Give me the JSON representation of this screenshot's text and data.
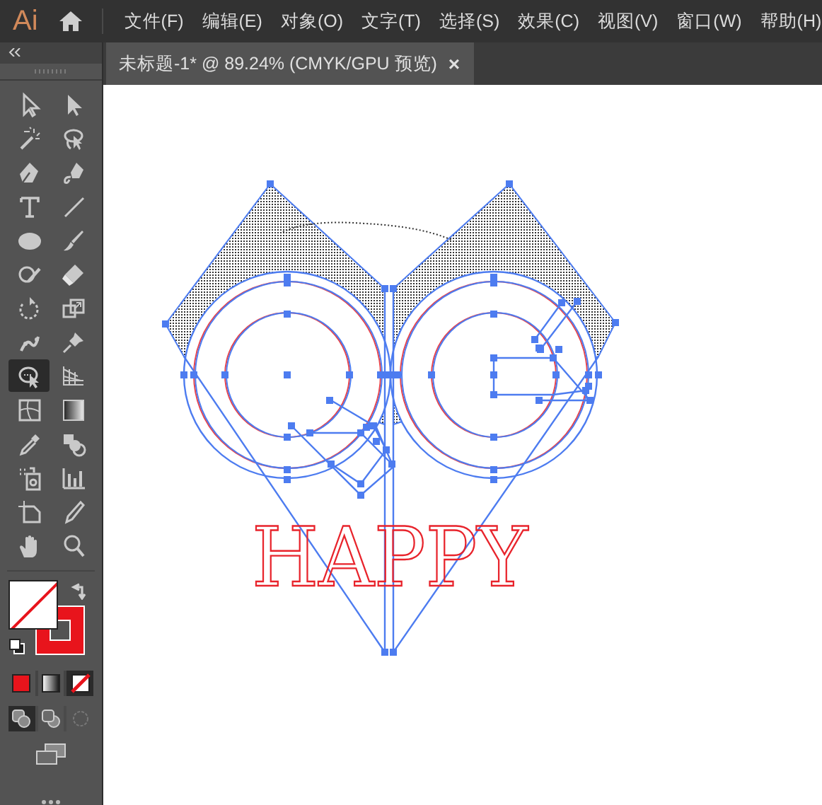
{
  "app": {
    "logo": "Ai"
  },
  "menu": [
    "文件(F)",
    "编辑(E)",
    "对象(O)",
    "文字(T)",
    "选择(S)",
    "效果(C)",
    "视图(V)",
    "窗口(W)",
    "帮助(H)"
  ],
  "document_tab": {
    "title": "未标题-1* @ 89.24% (CMYK/GPU 预览)",
    "close": "×"
  },
  "tools": [
    {
      "kind": "selection",
      "selected": false
    },
    {
      "kind": "direct-selection",
      "selected": false
    },
    {
      "kind": "magic-wand",
      "selected": false
    },
    {
      "kind": "lasso",
      "selected": false
    },
    {
      "kind": "pen",
      "selected": false
    },
    {
      "kind": "curvature",
      "selected": false
    },
    {
      "kind": "type",
      "selected": false
    },
    {
      "kind": "line",
      "selected": false
    },
    {
      "kind": "ellipse",
      "selected": false
    },
    {
      "kind": "brush",
      "selected": false
    },
    {
      "kind": "shaper",
      "selected": false
    },
    {
      "kind": "eraser",
      "selected": false
    },
    {
      "kind": "rotate",
      "selected": false
    },
    {
      "kind": "scale",
      "selected": false
    },
    {
      "kind": "puppet",
      "selected": false
    },
    {
      "kind": "pin",
      "selected": false
    },
    {
      "kind": "free-transform",
      "selected": true
    },
    {
      "kind": "perspective",
      "selected": false
    },
    {
      "kind": "mesh",
      "selected": false
    },
    {
      "kind": "gradient",
      "selected": false
    },
    {
      "kind": "eyedropper",
      "selected": false
    },
    {
      "kind": "blend",
      "selected": false
    },
    {
      "kind": "spray",
      "selected": false
    },
    {
      "kind": "graph",
      "selected": false
    },
    {
      "kind": "artboard",
      "selected": false
    },
    {
      "kind": "knife",
      "selected": false
    },
    {
      "kind": "hand",
      "selected": false
    },
    {
      "kind": "zoom",
      "selected": false
    }
  ],
  "color_modes": [
    {
      "kind": "color",
      "selected": false
    },
    {
      "kind": "gradient",
      "selected": false
    },
    {
      "kind": "none",
      "selected": true
    }
  ],
  "draw_modes": [
    {
      "kind": "normal",
      "selected": true
    },
    {
      "kind": "behind",
      "selected": false
    },
    {
      "kind": "inside",
      "selected": false
    }
  ],
  "artwork": {
    "text": "HAPPY"
  }
}
